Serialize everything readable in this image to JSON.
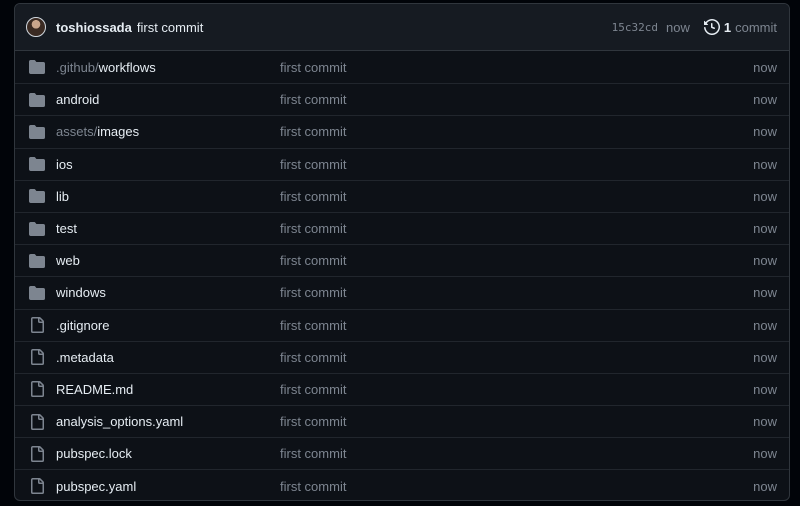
{
  "colors": {
    "background": "#0d1117",
    "header_background": "#161b22",
    "border": "#30363d",
    "folder_icon": "#7d8590",
    "primary_text": "#e6edf3",
    "muted_text": "#7d8590"
  },
  "latest_commit": {
    "author": "toshiossada",
    "message": "first commit",
    "sha": "15c32cd",
    "time": "now",
    "count": "1",
    "count_label": "commit",
    "history_icon": "history-icon"
  },
  "files": [
    {
      "type": "folder",
      "prefix": ".github/",
      "name": "workflows",
      "message": "first commit",
      "time": "now"
    },
    {
      "type": "folder",
      "prefix": "",
      "name": "android",
      "message": "first commit",
      "time": "now"
    },
    {
      "type": "folder",
      "prefix": "assets/",
      "name": "images",
      "message": "first commit",
      "time": "now"
    },
    {
      "type": "folder",
      "prefix": "",
      "name": "ios",
      "message": "first commit",
      "time": "now"
    },
    {
      "type": "folder",
      "prefix": "",
      "name": "lib",
      "message": "first commit",
      "time": "now"
    },
    {
      "type": "folder",
      "prefix": "",
      "name": "test",
      "message": "first commit",
      "time": "now"
    },
    {
      "type": "folder",
      "prefix": "",
      "name": "web",
      "message": "first commit",
      "time": "now"
    },
    {
      "type": "folder",
      "prefix": "",
      "name": "windows",
      "message": "first commit",
      "time": "now"
    },
    {
      "type": "file",
      "prefix": "",
      "name": ".gitignore",
      "message": "first commit",
      "time": "now"
    },
    {
      "type": "file",
      "prefix": "",
      "name": ".metadata",
      "message": "first commit",
      "time": "now"
    },
    {
      "type": "file",
      "prefix": "",
      "name": "README.md",
      "message": "first commit",
      "time": "now"
    },
    {
      "type": "file",
      "prefix": "",
      "name": "analysis_options.yaml",
      "message": "first commit",
      "time": "now"
    },
    {
      "type": "file",
      "prefix": "",
      "name": "pubspec.lock",
      "message": "first commit",
      "time": "now"
    },
    {
      "type": "file",
      "prefix": "",
      "name": "pubspec.yaml",
      "message": "first commit",
      "time": "now"
    }
  ]
}
